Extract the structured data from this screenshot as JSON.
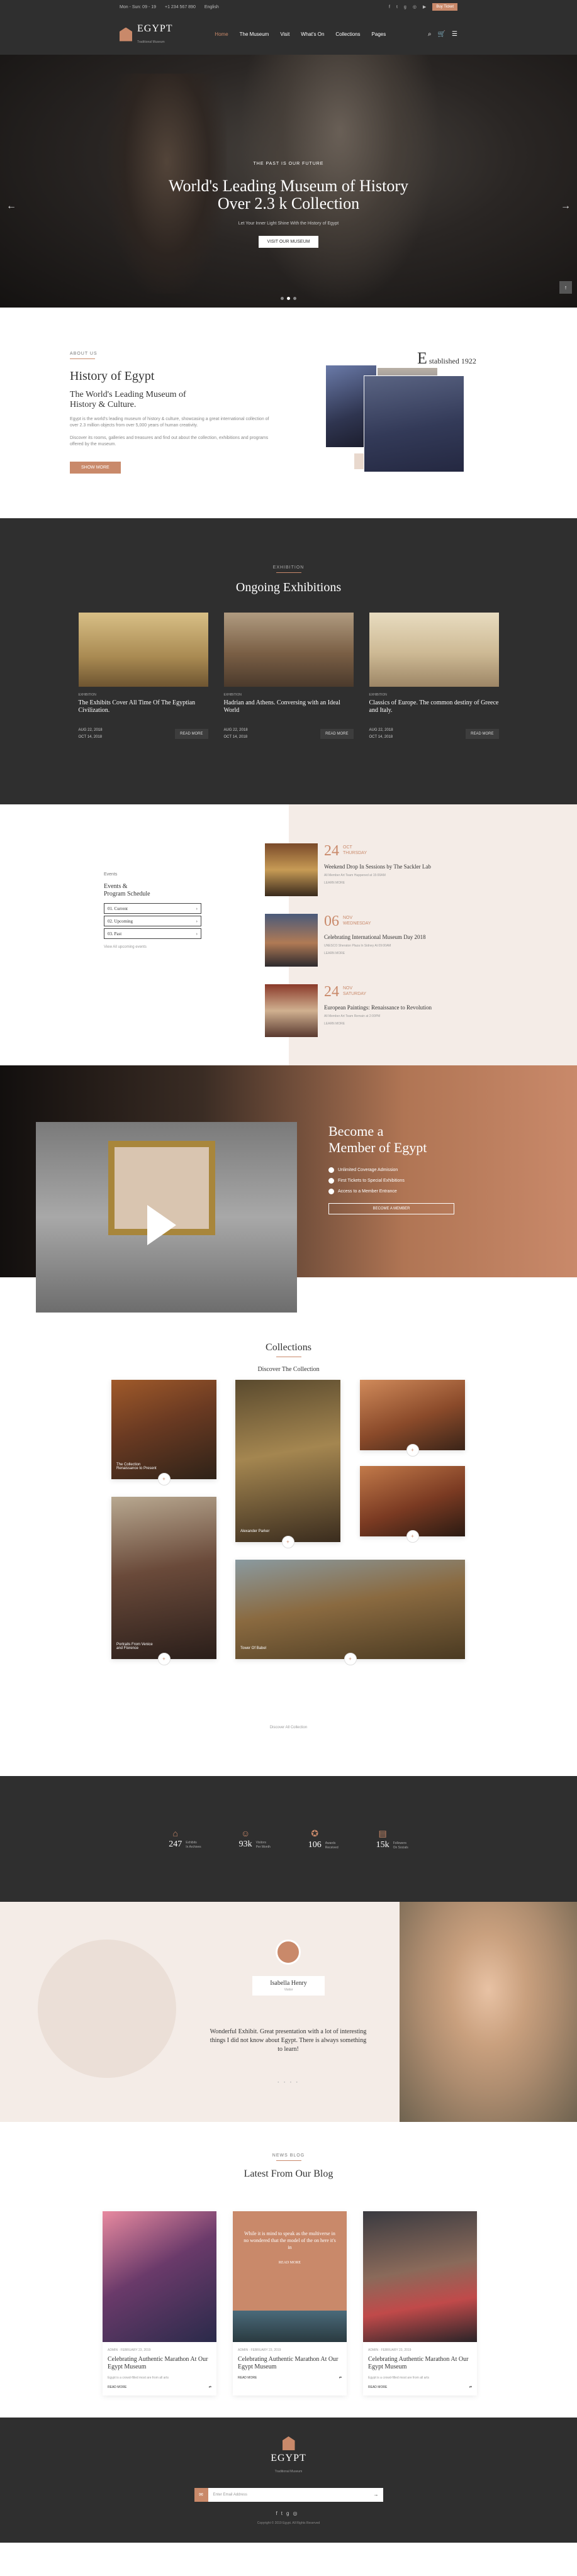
{
  "topbar": {
    "hours": "Mon - Sun: 09 - 19",
    "phone": "+1 234 567 890",
    "language": "English",
    "social_icons": [
      "facebook-icon",
      "twitter-icon",
      "google-icon",
      "instagram-icon",
      "youtube-icon"
    ],
    "ticket_button": "Buy Ticket"
  },
  "header": {
    "logo_title": "EGYPT",
    "logo_subtitle": "Traditional Museum",
    "nav": [
      "Home",
      "The Museum",
      "Visit",
      "What's On",
      "Collections",
      "Pages"
    ],
    "icons": [
      "search-icon",
      "cart-icon",
      "menu-icon"
    ]
  },
  "hero": {
    "kicker": "THE PAST IS OUR FUTURE",
    "title_line1": "World's Leading Museum of History",
    "title_line2": "Over 2.3 k Collection",
    "subtitle": "Let Your Inner Light Shine With the History of Egypt",
    "button": "VISIT OUR MUSEUM",
    "prev_arrow": "←",
    "next_arrow": "→",
    "scroll_top": "↑"
  },
  "history": {
    "kicker": "ABOUT US",
    "title": "History of Egypt",
    "subtitle_line1": "The World's Leading Museum of",
    "subtitle_line2": "History & Culture.",
    "para1": "Egypt is the world's leading museum of history & culture, showcasing a great international collection of over 2.3 million objects from over 5,000 years of human creativity.",
    "para2": "Discover its rooms, galleries and treasures and find out about the collection, exhibitions and programs offered by the museum.",
    "button": "SHOW MORE",
    "established_letter": "E",
    "established_label": "stablished",
    "established_year": "1922"
  },
  "exhibitions": {
    "kicker": "EXHIBITION",
    "title": "Ongoing Exhibitions",
    "items": [
      {
        "tag": "EXHIBITION",
        "title": "The Exhibits Cover All Time Of The Egyptian Civilization.",
        "from": "AUG 22, 2018",
        "to": "OCT 14, 2018",
        "button": "READ MORE"
      },
      {
        "tag": "EXHIBITION",
        "title": "Hadrian and Athens. Conversing with an Ideal World",
        "from": "AUG 22, 2018",
        "to": "OCT 14, 2018",
        "button": "READ MORE"
      },
      {
        "tag": "EXHIBITION",
        "title": "Classics of Europe. The common destiny of Greece and Italy.",
        "from": "AUG 22, 2018",
        "to": "OCT 14, 2018",
        "button": "READ MORE"
      }
    ]
  },
  "events": {
    "kicker": "Events",
    "title_line1": "Events &",
    "title_line2": "Program Schedule",
    "tabs": [
      "01. Current",
      "02. Upcoming",
      "03. Past"
    ],
    "tab_arrow": "›",
    "view_all": "View All upcoming events",
    "items": [
      {
        "day": "24",
        "month": "OCT",
        "weekday": "THURSDAY",
        "title": "Weekend Drop In Sessions by The Sackler Lab",
        "meta": "All Member Art Team Happened at 15:00AM",
        "link": "LEARN MORE"
      },
      {
        "day": "06",
        "month": "NOV",
        "weekday": "WEDNESDAY",
        "title": "Celebrating International Museum Day 2018",
        "meta": "UNESCO Sheraton Plaza In Sidney At 09:00AM",
        "link": "LEARN MORE"
      },
      {
        "day": "24",
        "month": "NOV",
        "weekday": "SATURDAY",
        "title": "European Paintings: Renaissance to Revolution",
        "meta": "All Member Art Team Remain at 2:00PM",
        "link": "LEARN MORE"
      }
    ]
  },
  "membership": {
    "title_line1": "Become a",
    "title_line2": "Member of Egypt",
    "benefits": [
      "Unlimited Coverage Admission",
      "First Tickets to Special Exhibitions",
      "Access to a Member Entrance"
    ],
    "button": "BECOME A MEMBER"
  },
  "collections": {
    "title": "Collections",
    "subtitle": "Discover The Collection",
    "cards": [
      {
        "caption_line1": "The Collection",
        "caption_line2": "Renaissance to Present",
        "icon": "+"
      },
      {
        "caption_line1": "Alexander Parker",
        "caption_line2": "",
        "icon": "+"
      },
      {
        "caption_line1": "",
        "caption_line2": "",
        "icon": "+"
      },
      {
        "caption_line1": "",
        "caption_line2": "",
        "icon": "+"
      },
      {
        "caption_line1": "Portraits From Venice",
        "caption_line2": "and Florence",
        "icon": "+"
      },
      {
        "caption_line1": "Tower Of Babel",
        "caption_line2": "",
        "icon": "+"
      }
    ],
    "view_more": "Discover All Collection"
  },
  "stats": [
    {
      "icon": "building-icon",
      "value": "247",
      "label_line1": "Exhibits",
      "label_line2": "In Archives"
    },
    {
      "icon": "people-icon",
      "value": "93k",
      "label_line1": "Visitors",
      "label_line2": "Per Month"
    },
    {
      "icon": "medal-icon",
      "value": "106",
      "label_line1": "Awards",
      "label_line2": "Received"
    },
    {
      "icon": "chart-icon",
      "value": "15k",
      "label_line1": "Followers",
      "label_line2": "On Socials"
    }
  ],
  "testimonial": {
    "name": "Isabella Henry",
    "role": "Visitor",
    "quote": "Wonderful Exhibit. Great presentation with a lot of interesting things I did not know about Egypt. There is always something to learn!",
    "dots": "• • • •"
  },
  "blog": {
    "kicker": "NEWS BLOG",
    "title": "Latest From Our Blog",
    "quote_card": "While it is mind to speak as the multiverse in no wondered that the model of the on here it's in",
    "quote_button": "READ MORE",
    "posts": [
      {
        "meta": "ADMIN · FEBRUARY 23, 2019",
        "title": "Celebrating Authentic Marathon At Our Egypt Museum",
        "excerpt": "Egypt is a crowd-filled most are from all arts",
        "read": "READ MORE",
        "share": "⇄"
      },
      {
        "meta": "ADMIN · FEBRUARY 23, 2019",
        "title": "Celebrating Authentic Marathon At Our Egypt Museum",
        "excerpt": "",
        "read": "READ MORE",
        "share": "⇄"
      },
      {
        "meta": "ADMIN · FEBRUARY 23, 2019",
        "title": "Celebrating Authentic Marathon At Our Egypt Museum",
        "excerpt": "Egypt is a crowd-filled most are from all arts",
        "read": "READ MORE",
        "share": "⇄"
      }
    ]
  },
  "footer": {
    "logo_title": "EGYPT",
    "logo_subtitle": "Traditional Museum",
    "subscribe_placeholder": "Enter Email Address",
    "subscribe_icon": "✉",
    "subscribe_go": "→",
    "social": [
      "facebook-icon",
      "twitter-icon",
      "google-icon",
      "instagram-icon"
    ],
    "copyright": "Copyright © 2019 Egypt. All Rights Reserved"
  },
  "colors": {
    "accent": "#c9896a",
    "dark": "#2f2f2f",
    "cream": "#f4ece7"
  }
}
